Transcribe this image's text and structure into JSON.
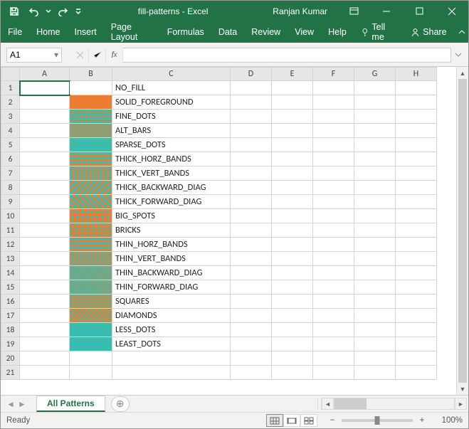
{
  "titlebar": {
    "filename": "fill-patterns  -  Excel",
    "user": "Ranjan Kumar"
  },
  "ribbon": {
    "tabs": [
      "File",
      "Home",
      "Insert",
      "Page Layout",
      "Formulas",
      "Data",
      "Review",
      "View",
      "Help"
    ],
    "tell_me_label": "Tell me",
    "share_label": "Share"
  },
  "namebox": {
    "ref": "A1"
  },
  "formula": {
    "value": ""
  },
  "columns": [
    "A",
    "B",
    "C",
    "D",
    "E",
    "F",
    "G",
    "H"
  ],
  "patterns": [
    "NO_FILL",
    "SOLID_FOREGROUND",
    "FINE_DOTS",
    "ALT_BARS",
    "SPARSE_DOTS",
    "THICK_HORZ_BANDS",
    "THICK_VERT_BANDS",
    "THICK_BACKWARD_DIAG",
    "THICK_FORWARD_DIAG",
    "BIG_SPOTS",
    "BRICKS",
    "THIN_HORZ_BANDS",
    "THIN_VERT_BANDS",
    "THIN_BACKWARD_DIAG",
    "THIN_FORWARD_DIAG",
    "SQUARES",
    "DIAMONDS",
    "LESS_DOTS",
    "LEAST_DOTS"
  ],
  "total_rows": 21,
  "sheet_tab": {
    "active": "All Patterns"
  },
  "statusbar": {
    "mode": "Ready",
    "zoom": "100%"
  },
  "colors": {
    "accent": "#217346",
    "pattern_fg": "#ed7d31",
    "pattern_bg": "#33bfb3"
  }
}
